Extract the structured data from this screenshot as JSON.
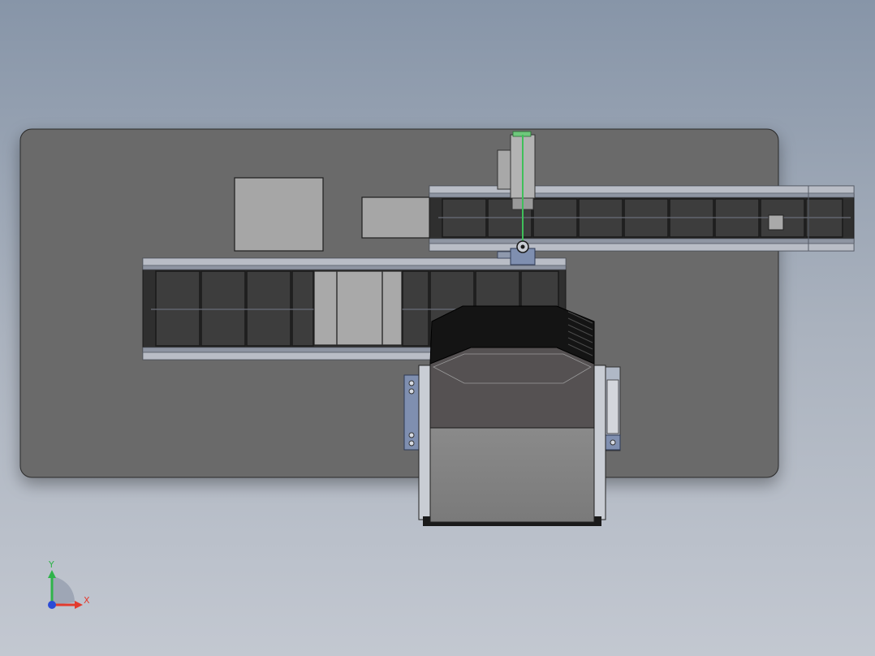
{
  "viewport": {
    "title": "",
    "background_top": "#8795a8",
    "background_bottom": "#c3c8d1"
  },
  "model": {
    "components": [
      "base-plate",
      "gray-block-large",
      "gray-block-small",
      "upper-conveyor",
      "lower-conveyor",
      "linear-actuator",
      "stacker-unit"
    ],
    "colors": {
      "plate": "#6b6b6b",
      "belt": "#3a3a3a",
      "rail": "#b8bcc4",
      "block": "#a4a4a4",
      "stacker_dark": "#1a1a1a",
      "stacker_body": "#808080",
      "guide_green": "#3fbf5a",
      "bracket_blue": "#7f8fb0"
    }
  },
  "triad": {
    "x_label": "X",
    "y_label": "Y",
    "x_color": "#e23b2e",
    "y_color": "#2fb34a",
    "z_color": "#2b4bd6",
    "icon": "coordinate-triad-icon"
  }
}
